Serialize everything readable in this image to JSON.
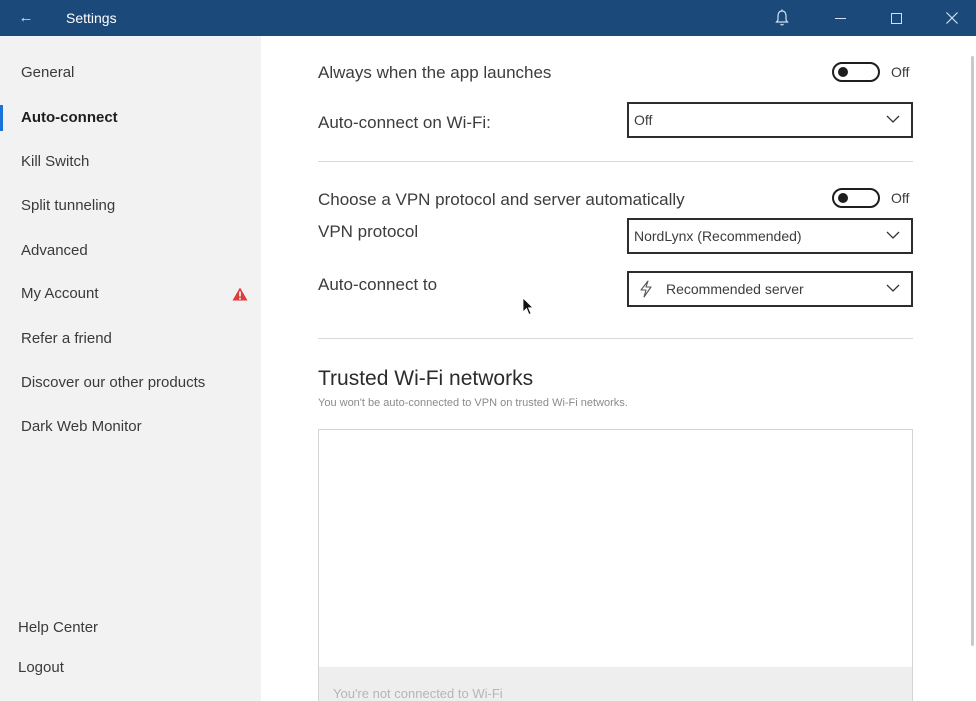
{
  "titlebar": {
    "title": "Settings",
    "back_icon": "back-arrow-icon",
    "color": "#1b4a7a"
  },
  "sidebar": {
    "items": [
      {
        "label": "General",
        "active": false
      },
      {
        "label": "Auto-connect",
        "active": true
      },
      {
        "label": "Kill Switch",
        "active": false
      },
      {
        "label": "Split tunneling",
        "active": false
      },
      {
        "label": "Advanced",
        "active": false
      },
      {
        "label": "My Account",
        "active": false,
        "badge_icon": "warning-icon"
      },
      {
        "label": "Refer a friend",
        "active": false
      },
      {
        "label": "Discover our other products",
        "active": false
      },
      {
        "label": "Dark Web Monitor",
        "active": false
      }
    ],
    "bottom_items": [
      {
        "label": "Help Center"
      },
      {
        "label": "Logout"
      }
    ],
    "accent": "#1a73d9",
    "warning_color": "#e03c3c"
  },
  "main": {
    "launch": {
      "label": "Always when the app launches",
      "toggle_state": "Off"
    },
    "wifi": {
      "label": "Auto-connect on Wi-Fi:",
      "value": "Off"
    },
    "auto_protocol": {
      "label": "Choose a VPN protocol and server automatically",
      "toggle_state": "Off"
    },
    "protocol": {
      "label": "VPN protocol",
      "value": "NordLynx (Recommended)"
    },
    "connect_to": {
      "label": "Auto-connect to",
      "value": "Recommended server",
      "icon": "lightning-icon"
    },
    "trusted": {
      "title": "Trusted Wi-Fi networks",
      "subtitle": "You won't be auto-connected to VPN on trusted Wi-Fi networks.",
      "footer": "You're not connected to Wi-Fi"
    }
  }
}
